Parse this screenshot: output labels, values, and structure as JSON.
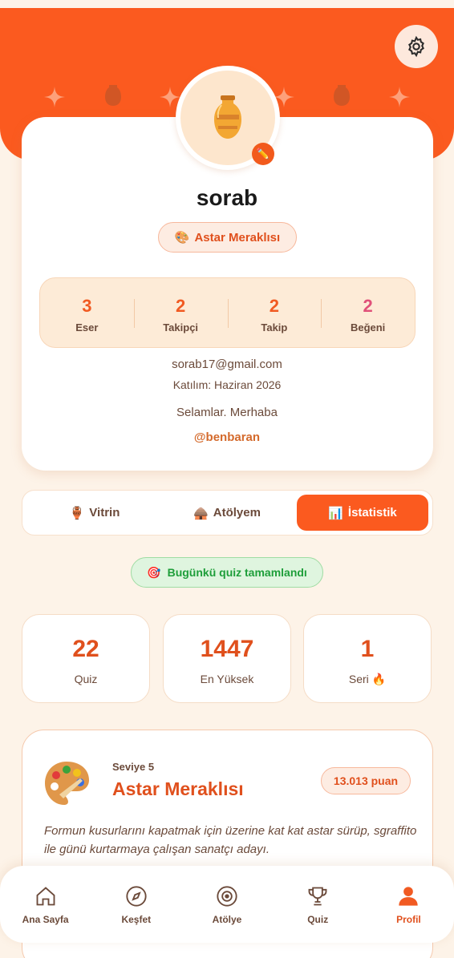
{
  "profile": {
    "username": "sorab",
    "title_emoji": "🎨",
    "title": "Astar Meraklısı",
    "email": "sorab17@gmail.com",
    "joined": "Katılım: Haziran 2026",
    "bio": "Selamlar. Merhaba",
    "handle": "@benbaran",
    "stats": [
      {
        "value": "3",
        "label": "Eser"
      },
      {
        "value": "2",
        "label": "Takipçi"
      },
      {
        "value": "2",
        "label": "Takip"
      },
      {
        "value": "2",
        "label": "Beğeni"
      }
    ]
  },
  "tabs": [
    {
      "emoji": "🏺",
      "label": "Vitrin"
    },
    {
      "emoji": "🛖",
      "label": "Atölyem"
    },
    {
      "emoji": "📊",
      "label": "İstatistik"
    }
  ],
  "quiz_status": {
    "emoji": "🎯",
    "text": "Bugünkü quiz tamamlandı"
  },
  "quiz_stats": [
    {
      "value": "22",
      "label": "Quiz"
    },
    {
      "value": "1447",
      "label": "En Yüksek"
    },
    {
      "value": "1",
      "label": "Seri 🔥"
    }
  ],
  "level": {
    "label": "Seviye 5",
    "title": "Astar Meraklısı",
    "points": "13.013 puan",
    "description": "Formun kusurlarını kapatmak için üzerine kat kat astar sürüp, sgraffito ile günü kurtarmaya çalışan sanatçı adayı."
  },
  "nav": [
    {
      "label": "Ana Sayfa",
      "icon": "home-icon"
    },
    {
      "label": "Keşfet",
      "icon": "compass-icon"
    },
    {
      "label": "Atölye",
      "icon": "target-icon"
    },
    {
      "label": "Quiz",
      "icon": "trophy-icon"
    },
    {
      "label": "Profil",
      "icon": "user-icon"
    }
  ],
  "colors": {
    "accent": "#fb5a1f",
    "background": "#fdf3e8",
    "success": "#1e9e3a"
  }
}
